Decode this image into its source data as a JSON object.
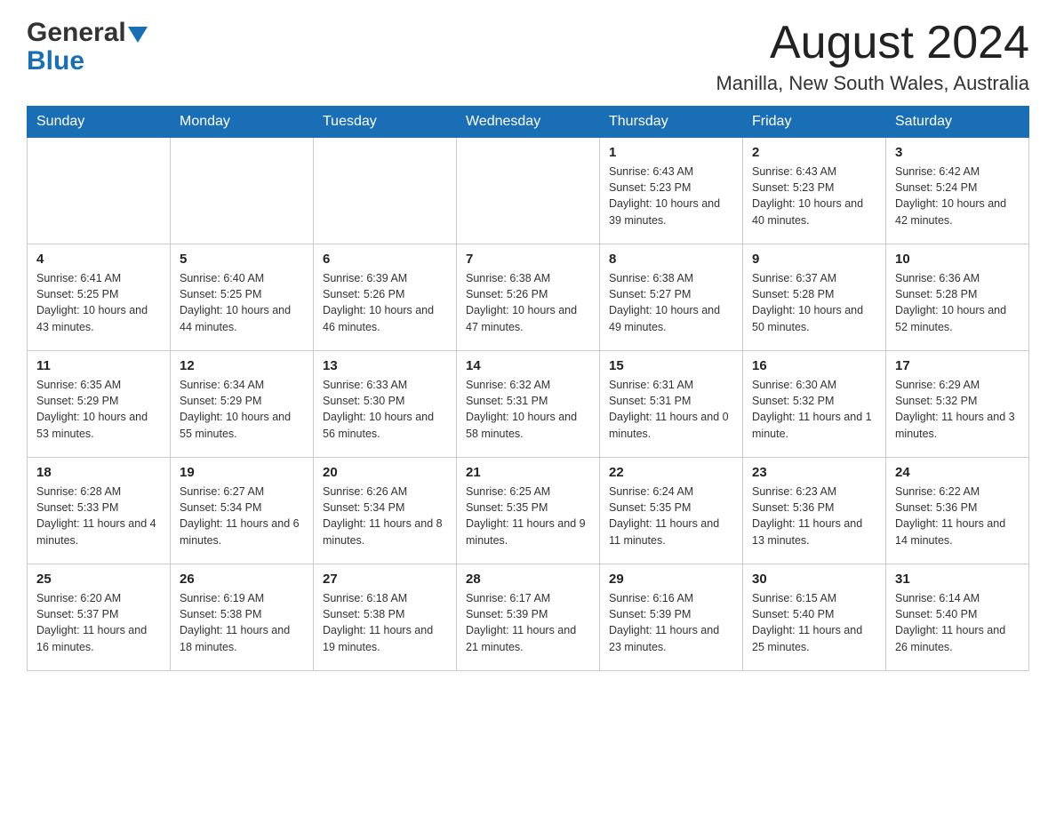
{
  "header": {
    "logo_general": "General",
    "logo_blue": "Blue",
    "month_title": "August 2024",
    "location": "Manilla, New South Wales, Australia"
  },
  "days_of_week": [
    "Sunday",
    "Monday",
    "Tuesday",
    "Wednesday",
    "Thursday",
    "Friday",
    "Saturday"
  ],
  "weeks": [
    [
      {
        "num": "",
        "info": ""
      },
      {
        "num": "",
        "info": ""
      },
      {
        "num": "",
        "info": ""
      },
      {
        "num": "",
        "info": ""
      },
      {
        "num": "1",
        "info": "Sunrise: 6:43 AM\nSunset: 5:23 PM\nDaylight: 10 hours and 39 minutes."
      },
      {
        "num": "2",
        "info": "Sunrise: 6:43 AM\nSunset: 5:23 PM\nDaylight: 10 hours and 40 minutes."
      },
      {
        "num": "3",
        "info": "Sunrise: 6:42 AM\nSunset: 5:24 PM\nDaylight: 10 hours and 42 minutes."
      }
    ],
    [
      {
        "num": "4",
        "info": "Sunrise: 6:41 AM\nSunset: 5:25 PM\nDaylight: 10 hours and 43 minutes."
      },
      {
        "num": "5",
        "info": "Sunrise: 6:40 AM\nSunset: 5:25 PM\nDaylight: 10 hours and 44 minutes."
      },
      {
        "num": "6",
        "info": "Sunrise: 6:39 AM\nSunset: 5:26 PM\nDaylight: 10 hours and 46 minutes."
      },
      {
        "num": "7",
        "info": "Sunrise: 6:38 AM\nSunset: 5:26 PM\nDaylight: 10 hours and 47 minutes."
      },
      {
        "num": "8",
        "info": "Sunrise: 6:38 AM\nSunset: 5:27 PM\nDaylight: 10 hours and 49 minutes."
      },
      {
        "num": "9",
        "info": "Sunrise: 6:37 AM\nSunset: 5:28 PM\nDaylight: 10 hours and 50 minutes."
      },
      {
        "num": "10",
        "info": "Sunrise: 6:36 AM\nSunset: 5:28 PM\nDaylight: 10 hours and 52 minutes."
      }
    ],
    [
      {
        "num": "11",
        "info": "Sunrise: 6:35 AM\nSunset: 5:29 PM\nDaylight: 10 hours and 53 minutes."
      },
      {
        "num": "12",
        "info": "Sunrise: 6:34 AM\nSunset: 5:29 PM\nDaylight: 10 hours and 55 minutes."
      },
      {
        "num": "13",
        "info": "Sunrise: 6:33 AM\nSunset: 5:30 PM\nDaylight: 10 hours and 56 minutes."
      },
      {
        "num": "14",
        "info": "Sunrise: 6:32 AM\nSunset: 5:31 PM\nDaylight: 10 hours and 58 minutes."
      },
      {
        "num": "15",
        "info": "Sunrise: 6:31 AM\nSunset: 5:31 PM\nDaylight: 11 hours and 0 minutes."
      },
      {
        "num": "16",
        "info": "Sunrise: 6:30 AM\nSunset: 5:32 PM\nDaylight: 11 hours and 1 minute."
      },
      {
        "num": "17",
        "info": "Sunrise: 6:29 AM\nSunset: 5:32 PM\nDaylight: 11 hours and 3 minutes."
      }
    ],
    [
      {
        "num": "18",
        "info": "Sunrise: 6:28 AM\nSunset: 5:33 PM\nDaylight: 11 hours and 4 minutes."
      },
      {
        "num": "19",
        "info": "Sunrise: 6:27 AM\nSunset: 5:34 PM\nDaylight: 11 hours and 6 minutes."
      },
      {
        "num": "20",
        "info": "Sunrise: 6:26 AM\nSunset: 5:34 PM\nDaylight: 11 hours and 8 minutes."
      },
      {
        "num": "21",
        "info": "Sunrise: 6:25 AM\nSunset: 5:35 PM\nDaylight: 11 hours and 9 minutes."
      },
      {
        "num": "22",
        "info": "Sunrise: 6:24 AM\nSunset: 5:35 PM\nDaylight: 11 hours and 11 minutes."
      },
      {
        "num": "23",
        "info": "Sunrise: 6:23 AM\nSunset: 5:36 PM\nDaylight: 11 hours and 13 minutes."
      },
      {
        "num": "24",
        "info": "Sunrise: 6:22 AM\nSunset: 5:36 PM\nDaylight: 11 hours and 14 minutes."
      }
    ],
    [
      {
        "num": "25",
        "info": "Sunrise: 6:20 AM\nSunset: 5:37 PM\nDaylight: 11 hours and 16 minutes."
      },
      {
        "num": "26",
        "info": "Sunrise: 6:19 AM\nSunset: 5:38 PM\nDaylight: 11 hours and 18 minutes."
      },
      {
        "num": "27",
        "info": "Sunrise: 6:18 AM\nSunset: 5:38 PM\nDaylight: 11 hours and 19 minutes."
      },
      {
        "num": "28",
        "info": "Sunrise: 6:17 AM\nSunset: 5:39 PM\nDaylight: 11 hours and 21 minutes."
      },
      {
        "num": "29",
        "info": "Sunrise: 6:16 AM\nSunset: 5:39 PM\nDaylight: 11 hours and 23 minutes."
      },
      {
        "num": "30",
        "info": "Sunrise: 6:15 AM\nSunset: 5:40 PM\nDaylight: 11 hours and 25 minutes."
      },
      {
        "num": "31",
        "info": "Sunrise: 6:14 AM\nSunset: 5:40 PM\nDaylight: 11 hours and 26 minutes."
      }
    ]
  ]
}
